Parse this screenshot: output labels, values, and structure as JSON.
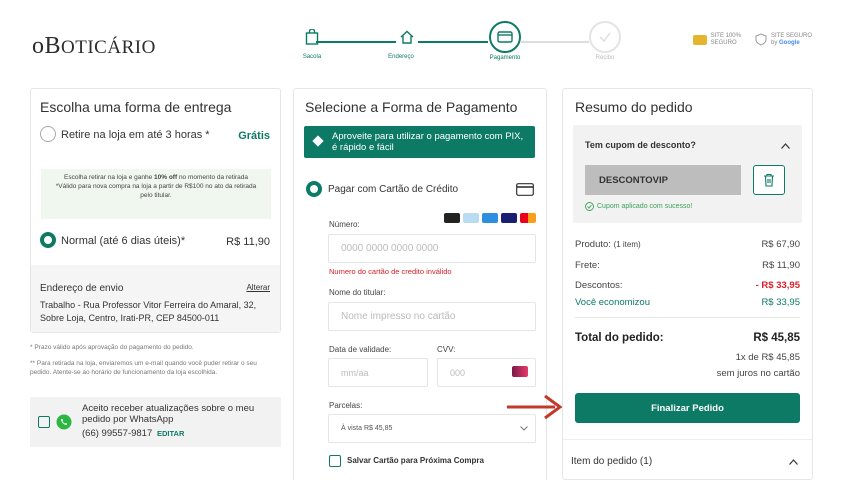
{
  "brand": {
    "logo_o": "o",
    "logo_b": "B",
    "logo_rest": "OTICÁRIO"
  },
  "steps": [
    {
      "label": "Sacola",
      "state": "done"
    },
    {
      "label": "Endereço",
      "state": "done"
    },
    {
      "label": "Pagamento",
      "state": "active"
    },
    {
      "label": "Recibo",
      "state": "pending"
    }
  ],
  "badges": {
    "site_seguro": {
      "line1": "SITE 100%",
      "line2": "SEGURO"
    },
    "google": {
      "line1": "SITE SEGURO",
      "line2_prefix": "by",
      "line2_brand": "Google"
    }
  },
  "delivery": {
    "title": "Escolha uma forma de entrega",
    "pickup_label": "Retire na loja em até 3 horas *",
    "pickup_price": "Grátis",
    "promo_prefix": "Escolha retirar na loja e ganhe ",
    "promo_bold": "10% off",
    "promo_suffix": " no momento da retirada",
    "promo_note": "*Válido para nova compra na loja a partir de R$100 no ato da retirada pelo titular.",
    "normal_label": "Normal (até 6 dias úteis)*",
    "normal_price": "R$ 11,90",
    "address_title": "Endereço de envio",
    "address_change": "Alterar",
    "address_text": "Trabalho - Rua Professor Vitor Ferreira do Amaral, 32, Sobre Loja, Centro, Irati-PR, CEP 84500-011",
    "footnote1": "* Prazo válido após aprovação do pagamento do pedido.",
    "footnote2": "** Para retirada na loja, enviaremos um e-mail quando você puder retirar o seu pedido. Atente-se ao horário de funcionamento da loja escolhida.",
    "whatsapp_text": "Aceito receber atualizações sobre o meu pedido por WhatsApp",
    "whatsapp_phone": "(66) 99557-9817",
    "whatsapp_edit": "EDITAR"
  },
  "payment": {
    "title": "Selecione a Forma de Pagamento",
    "pix_banner": "Aproveite para utilizar o pagamento com PIX, é rápido e fácil",
    "card_option": "Pagar com Cartão de Crédito",
    "number_label": "Número:",
    "number_placeholder": "0000 0000 0000 0000",
    "number_error": "Numero do cartão de credito inválido",
    "holder_label": "Nome do titular:",
    "holder_placeholder": "Nome impresso no cartão",
    "expiry_label": "Data de validade:",
    "expiry_placeholder": "mm/aa",
    "cvv_label": "CVV:",
    "cvv_placeholder": "000",
    "installments_label": "Parcelas:",
    "installments_value": "À vista R$ 45,85",
    "save_card": "Salvar Cartão para Próxima Compra",
    "card_brands": [
      "elo",
      "diners",
      "amex",
      "visa",
      "mastercard"
    ]
  },
  "summary": {
    "title": "Resumo do pedido",
    "coupon_question": "Tem cupom de desconto?",
    "coupon_code": "DESCONTOVIP",
    "coupon_success": "Cupom aplicado com sucesso!",
    "product_label": "Produto:",
    "product_count": "(1 item)",
    "product_value": "R$ 67,90",
    "shipping_label": "Frete:",
    "shipping_value": "R$ 11,90",
    "discount_label": "Descontos:",
    "discount_value": "- R$ 33,95",
    "saved_label": "Você economizou",
    "saved_value": "R$ 33,95",
    "total_label": "Total do pedido:",
    "total_value": "R$ 45,85",
    "installment_line": "1x de R$ 45,85",
    "interest_line": "sem juros no cartão",
    "checkout_button": "Finalizar Pedido",
    "items_label": "Item do pedido (1)"
  },
  "colors": {
    "primary": "#0d7a66",
    "error": "#d6202a",
    "arrow": "#c0392b"
  }
}
